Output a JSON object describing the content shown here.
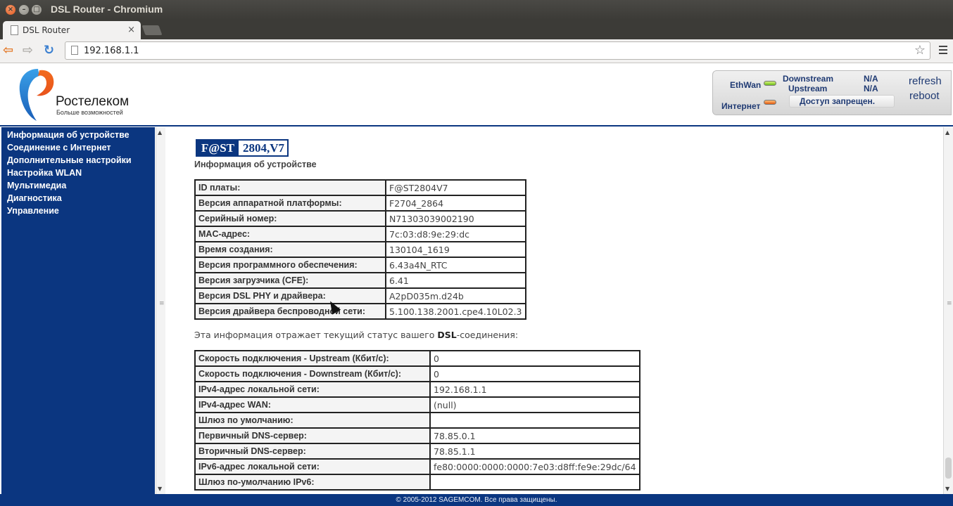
{
  "window": {
    "title": "DSL Router - Chromium"
  },
  "tab": {
    "label": "DSL Router",
    "close": "×"
  },
  "address_bar": {
    "url": "192.168.1.1"
  },
  "header": {
    "logo_name": "Ростелеком",
    "logo_slogan": "Больше возможностей",
    "status": {
      "ethwan_label": "EthWan",
      "internet_label": "Интернет",
      "downstream_label": "Downstream",
      "upstream_label": "Upstream",
      "downstream_value": "N/A",
      "upstream_value": "N/A",
      "access_text": "Доступ запрещен.",
      "ethwan_led_color": "#6fbf1a",
      "internet_led_color": "#e25a10"
    },
    "refresh_label": "refresh",
    "reboot_label": "reboot"
  },
  "sidebar": {
    "items": [
      {
        "label": "Информация об устройстве"
      },
      {
        "label": "Соединение с Интернет"
      },
      {
        "label": "Дополнительные настройки"
      },
      {
        "label": "Настройка WLAN"
      },
      {
        "label": "Мультимедиа"
      },
      {
        "label": "Диагностика"
      },
      {
        "label": "Управление"
      }
    ]
  },
  "main": {
    "brand_left": "F@ST",
    "brand_right": "2804,V7",
    "title": "Информация об устройстве",
    "device_info": [
      {
        "key": "ID платы:",
        "value": "F@ST2804V7"
      },
      {
        "key": "Версия аппаратной платформы:",
        "value": "F2704_2864"
      },
      {
        "key": "Серийный номер:",
        "value": "N71303039002190"
      },
      {
        "key": "MAC-адрес:",
        "value": "7c:03:d8:9e:29:dc"
      },
      {
        "key": "Время создания:",
        "value": "130104_1619"
      },
      {
        "key": "Версия программного обеспечения:",
        "value": "6.43a4N_RTC"
      },
      {
        "key": "Версия загрузчика (CFE):",
        "value": "6.41"
      },
      {
        "key": "Версия DSL PHY и драйвера:",
        "value": "A2pD035m.d24b"
      },
      {
        "key": "Версия драйвера беспроводной сети:",
        "value": "5.100.138.2001.cpe4.10L02.3"
      }
    ],
    "note_prefix": "Эта информация отражает текущий статус вашего ",
    "note_bold": "DSL",
    "note_suffix": "-соединения:",
    "connection_info": [
      {
        "key": "Скорость подключения - Upstream (Кбит/с):",
        "value": "0"
      },
      {
        "key": "Скорость подключения - Downstream (Кбит/с):",
        "value": "0"
      },
      {
        "key": "IPv4-адрес локальной сети:",
        "value": "192.168.1.1"
      },
      {
        "key": "IPv4-адрес WAN:",
        "value": "(null)"
      },
      {
        "key": "Шлюз по умолчанию:",
        "value": ""
      },
      {
        "key": "Первичный DNS-сервер:",
        "value": "78.85.0.1"
      },
      {
        "key": "Вторичный DNS-сервер:",
        "value": "78.85.1.1"
      },
      {
        "key": "IPv6-адрес локальной сети:",
        "value": "fe80:0000:0000:0000:7e03:d8ff:fe9e:29dc/64"
      },
      {
        "key": "Шлюз по-умолчанию IPv6:",
        "value": ""
      }
    ]
  },
  "footer": {
    "text": "© 2005-2012 SAGEMCOM. Все права защищены."
  }
}
